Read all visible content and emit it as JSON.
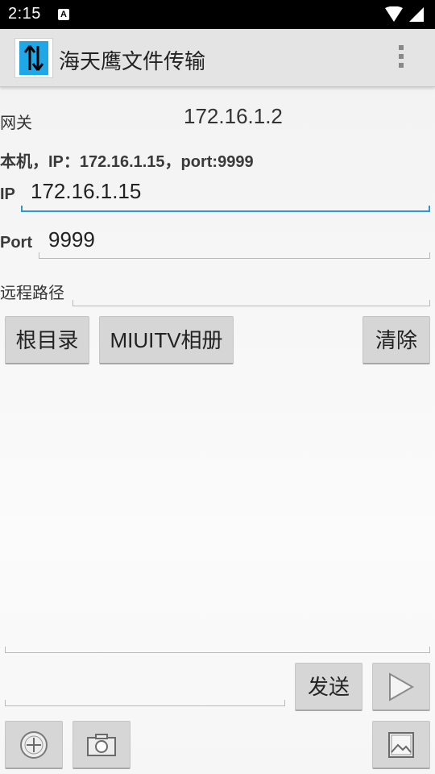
{
  "status_bar": {
    "time": "2:15",
    "notif_letter": "A"
  },
  "app": {
    "title": "海天鹰文件传输"
  },
  "gateway": {
    "label": "网关",
    "value": "172.16.1.2"
  },
  "local_info": "本机，IP：172.16.1.15，port:9999",
  "ip_field": {
    "label": "IP",
    "value": "172.16.1.15"
  },
  "port_field": {
    "label": "Port",
    "value": "9999"
  },
  "remote_path": {
    "label": "远程路径",
    "value": ""
  },
  "buttons": {
    "root": "根目录",
    "miuitv": "MIUITV相册",
    "clear": "清除",
    "send": "发送"
  },
  "message_input": {
    "value": ""
  },
  "icons": {
    "send": "play-triangle-icon",
    "add": "add-circle-icon",
    "camera": "camera-icon",
    "gallery": "image-icon",
    "menu": "overflow-menu-icon"
  },
  "colors": {
    "accent": "#2a9bd2",
    "app_icon": "#1ea8e8"
  }
}
